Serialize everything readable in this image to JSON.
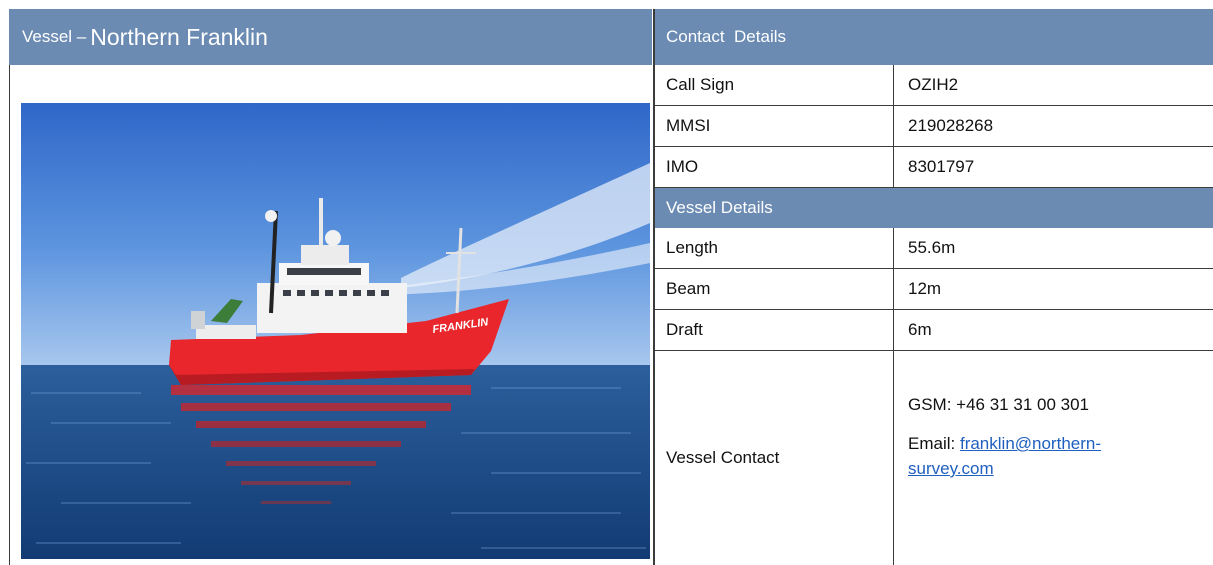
{
  "vessel": {
    "prefix": "Vessel –",
    "name": "Northern Franklin",
    "hull_text": "FRANKLIN"
  },
  "contact_details": {
    "header": "Contact  Details",
    "rows": [
      {
        "label": "Call Sign",
        "value": "OZIH2"
      },
      {
        "label": "MMSI",
        "value": "219028268"
      },
      {
        "label": "IMO",
        "value": "8301797"
      }
    ]
  },
  "vessel_details": {
    "header": "Vessel Details",
    "rows": [
      {
        "label": "Length",
        "value": "55.6m"
      },
      {
        "label": "Beam",
        "value": "12m"
      },
      {
        "label": "Draft",
        "value": "6m"
      }
    ],
    "contact": {
      "label": "Vessel Contact",
      "gsm": "GSM: +46 31 31 00 301",
      "email_label": "Email:",
      "email": "franklin@northern-survey.com"
    }
  },
  "colors": {
    "header_bg": "#6b8bb3",
    "link": "#1f5fbf",
    "hull": "#e8262b"
  }
}
